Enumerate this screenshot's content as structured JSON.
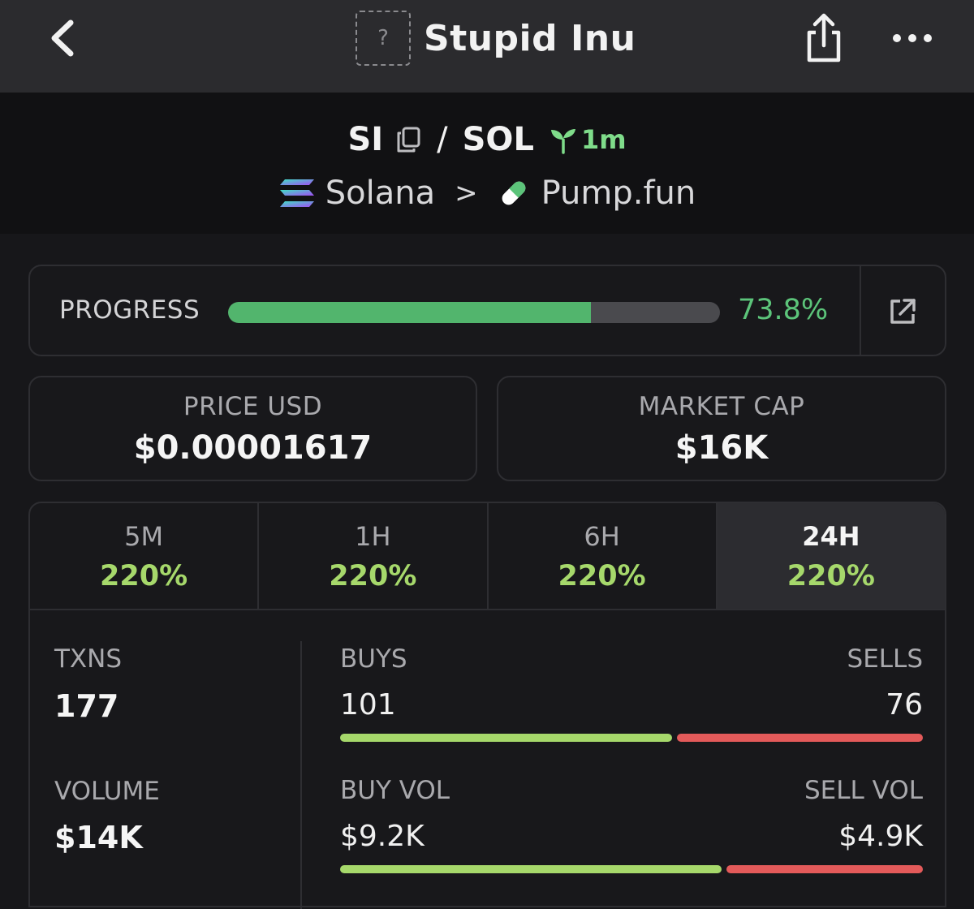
{
  "nav": {
    "title": "Stupid Inu",
    "placeholder_glyph": "?"
  },
  "pair": {
    "base": "SI",
    "slash": "/",
    "quote": "SOL",
    "age": "1m",
    "chain": "Solana",
    "chevron": ">",
    "dex": "Pump.fun"
  },
  "progress": {
    "label": "PROGRESS",
    "value_text": "73.8%",
    "fraction": 0.738,
    "fill_color": "#52b56d"
  },
  "stats": {
    "price_label": "PRICE USD",
    "price_value": "$0.00001617",
    "mcap_label": "MARKET CAP",
    "mcap_value": "$16K"
  },
  "timeframes": [
    {
      "name": "5M",
      "change": "220%",
      "active": false
    },
    {
      "name": "1H",
      "change": "220%",
      "active": false
    },
    {
      "name": "6H",
      "change": "220%",
      "active": false
    },
    {
      "name": "24H",
      "change": "220%",
      "active": true
    }
  ],
  "activity": {
    "txns_label": "TXNS",
    "txns_value": "177",
    "volume_label": "VOLUME",
    "volume_value": "$14K",
    "buys_label": "BUYS",
    "buys_value": "101",
    "sells_label": "SELLS",
    "sells_value": "76",
    "buys_ratio": 0.57,
    "buy_vol_label": "BUY VOL",
    "buy_vol_value": "$9.2K",
    "sell_vol_label": "SELL VOL",
    "sell_vol_value": "$4.9K",
    "buy_vol_ratio": 0.655
  },
  "colors": {
    "accent_green": "#5cc47a",
    "change_green": "#a6d86b",
    "sell_red": "#e35a5a"
  }
}
